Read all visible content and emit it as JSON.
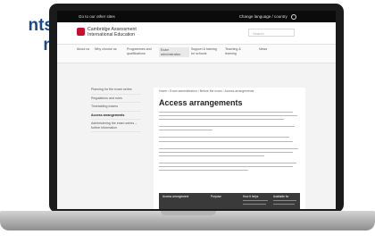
{
  "promo": {
    "line1": "nts",
    "line2": "n"
  },
  "topbar": {
    "left_text": "Go to our other sites",
    "right_text": "Change language / country"
  },
  "header": {
    "logo_line1": "Cambridge Assessment",
    "logo_line2": "International Education",
    "search_placeholder": "Search"
  },
  "nav": {
    "items": [
      {
        "label": "About us"
      },
      {
        "label": "Why choose us"
      },
      {
        "label": "Programmes and qualifications"
      },
      {
        "label": "Exam administration"
      },
      {
        "label": "Support & training for schools"
      },
      {
        "label": "Teaching & learning"
      },
      {
        "label": "News"
      }
    ]
  },
  "sidebar": {
    "items": [
      {
        "label": "Planning for the exam series"
      },
      {
        "label": "Regulations and rules"
      },
      {
        "label": "Timetabling exams"
      },
      {
        "label": "Access arrangements"
      },
      {
        "label": "Administering the exam series – further information"
      }
    ]
  },
  "breadcrumb": "Home › Exam administration › Before the exam › Access arrangements",
  "page_title": "Access arrangements",
  "table": {
    "headers": [
      "Access arrangement",
      "Purpose",
      "How it helps",
      "Available for"
    ]
  }
}
